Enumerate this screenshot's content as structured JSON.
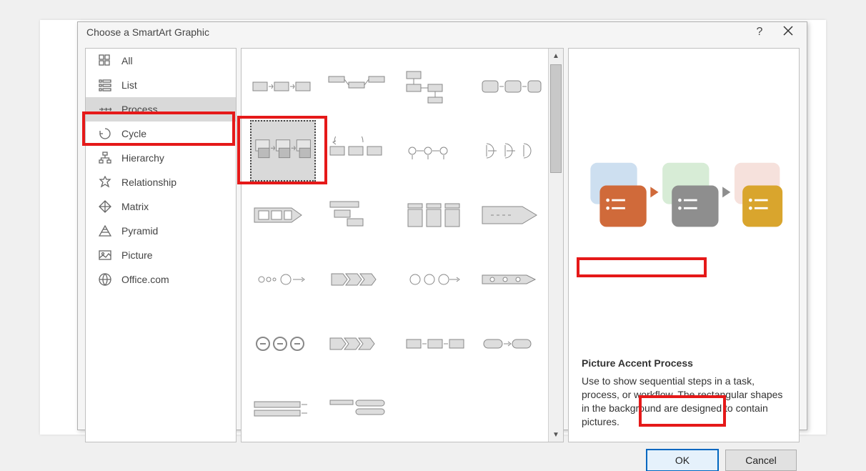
{
  "dialog": {
    "title": "Choose a SmartArt Graphic",
    "help_symbol": "?",
    "close_label": "Close"
  },
  "sidebar": {
    "items": [
      {
        "id": "all",
        "label": "All",
        "icon": "grid-icon",
        "selected": false
      },
      {
        "id": "list",
        "label": "List",
        "icon": "list-icon",
        "selected": false
      },
      {
        "id": "process",
        "label": "Process",
        "icon": "arrows-icon",
        "selected": true
      },
      {
        "id": "cycle",
        "label": "Cycle",
        "icon": "cycle-icon",
        "selected": false
      },
      {
        "id": "hierarchy",
        "label": "Hierarchy",
        "icon": "hierarchy-icon",
        "selected": false
      },
      {
        "id": "relationship",
        "label": "Relationship",
        "icon": "relationship-icon",
        "selected": false
      },
      {
        "id": "matrix",
        "label": "Matrix",
        "icon": "matrix-icon",
        "selected": false
      },
      {
        "id": "pyramid",
        "label": "Pyramid",
        "icon": "pyramid-icon",
        "selected": false
      },
      {
        "id": "picture",
        "label": "Picture",
        "icon": "picture-icon",
        "selected": false
      },
      {
        "id": "officecom",
        "label": "Office.com",
        "icon": "globe-icon",
        "selected": false
      }
    ]
  },
  "gallery": {
    "selected_index": 4,
    "rows_visible": 5,
    "cols": 4
  },
  "preview": {
    "name": "Picture Accent Process",
    "description": "Use to show sequential steps in a task, process, or workflow. The rectangular shapes in the background are designed to contain pictures."
  },
  "footer": {
    "ok_label": "OK",
    "cancel_label": "Cancel"
  },
  "highlights": [
    "sidebar-process",
    "thumb-selected",
    "preview-name",
    "ok-button"
  ]
}
